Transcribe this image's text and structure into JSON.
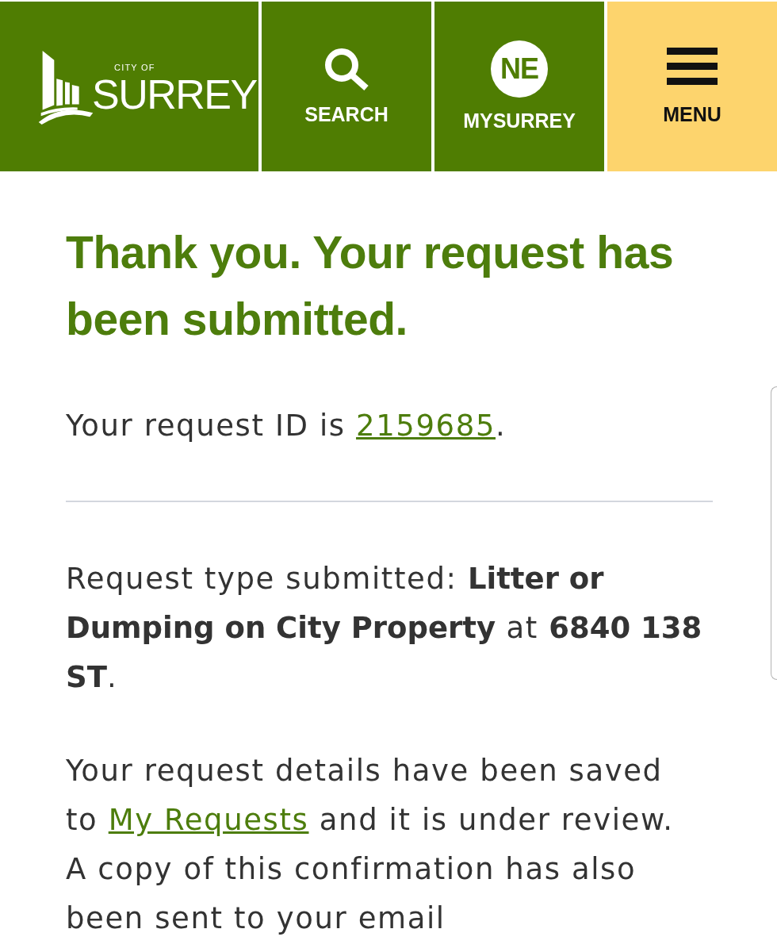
{
  "header": {
    "logo": {
      "small_text": "CITY OF",
      "text": "SURREY"
    },
    "nav": [
      {
        "kind": "search",
        "label": "SEARCH"
      },
      {
        "kind": "profile",
        "badge": "NE",
        "label": "MYSURREY"
      },
      {
        "kind": "menu",
        "label": "MENU"
      }
    ]
  },
  "confirmation": {
    "heading": "Thank you. Your request has been submitted.",
    "request_id": {
      "before": "Your request ID is ",
      "link": "2159685",
      "after": "."
    },
    "request_type": "Request type submitted: **Litter or Dumping on City Property** at **6840 138 ST**.",
    "details": {
      "before": "Your request details have been saved to ",
      "link": "My Requests",
      "after": " and it is under review. A copy of this confirmation has also been sent to your email"
    }
  }
}
